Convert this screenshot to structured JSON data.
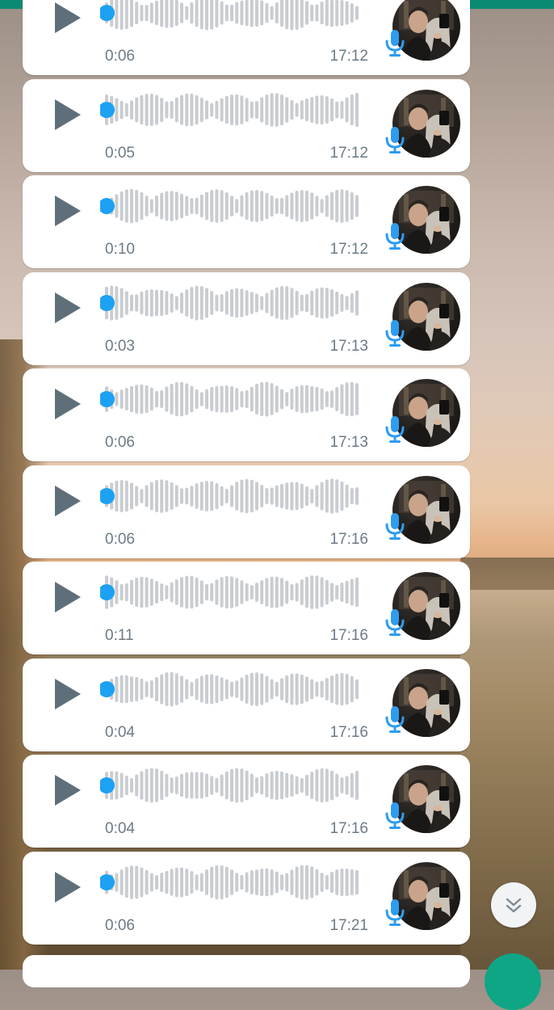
{
  "theme": {
    "accent": "#0b8a71",
    "progress_dot": "#1da1f2",
    "mic_color": "#2e9cf0",
    "play_color": "#5f6f7a",
    "waveform_color": "#c9cdd1",
    "meta_text": "#6c7b85"
  },
  "icons": {
    "play": "play-icon",
    "mic": "microphone-icon",
    "scroll_down": "double-chevron-down-icon"
  },
  "messages": [
    {
      "duration": "0:06",
      "time": "17:12",
      "progress": 0
    },
    {
      "duration": "0:05",
      "time": "17:12",
      "progress": 0
    },
    {
      "duration": "0:10",
      "time": "17:12",
      "progress": 0
    },
    {
      "duration": "0:03",
      "time": "17:13",
      "progress": 0
    },
    {
      "duration": "0:06",
      "time": "17:13",
      "progress": 0
    },
    {
      "duration": "0:06",
      "time": "17:16",
      "progress": 0
    },
    {
      "duration": "0:11",
      "time": "17:16",
      "progress": 0
    },
    {
      "duration": "0:04",
      "time": "17:16",
      "progress": 0
    },
    {
      "duration": "0:04",
      "time": "17:16",
      "progress": 0
    },
    {
      "duration": "0:06",
      "time": "17:21",
      "progress": 0
    }
  ]
}
